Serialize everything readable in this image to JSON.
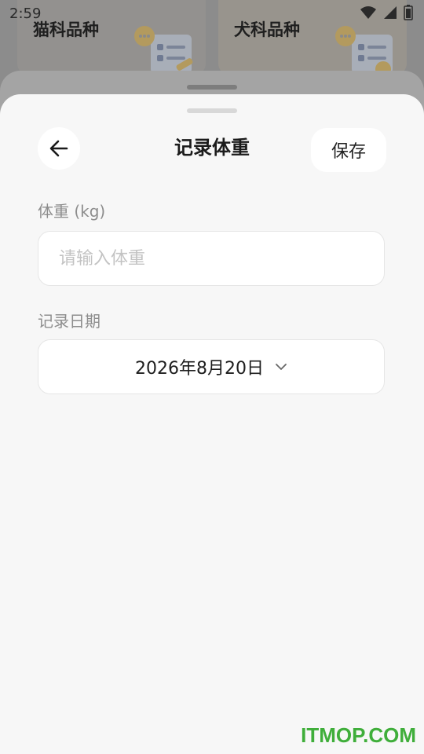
{
  "status_bar": {
    "time": "2:59"
  },
  "background": {
    "cards": [
      {
        "title": "猫科品种"
      },
      {
        "title": "犬科品种"
      }
    ]
  },
  "sheet": {
    "title": "记录体重",
    "save_label": "保存",
    "weight": {
      "label": "体重 (kg)",
      "placeholder": "请输入体重",
      "value": ""
    },
    "date": {
      "label": "记录日期",
      "value": "2026年8月20日"
    }
  },
  "watermark": "ITMOP.COM",
  "colors": {
    "sheet_bg": "#f7f7f7",
    "watermark": "#3fae3a"
  }
}
